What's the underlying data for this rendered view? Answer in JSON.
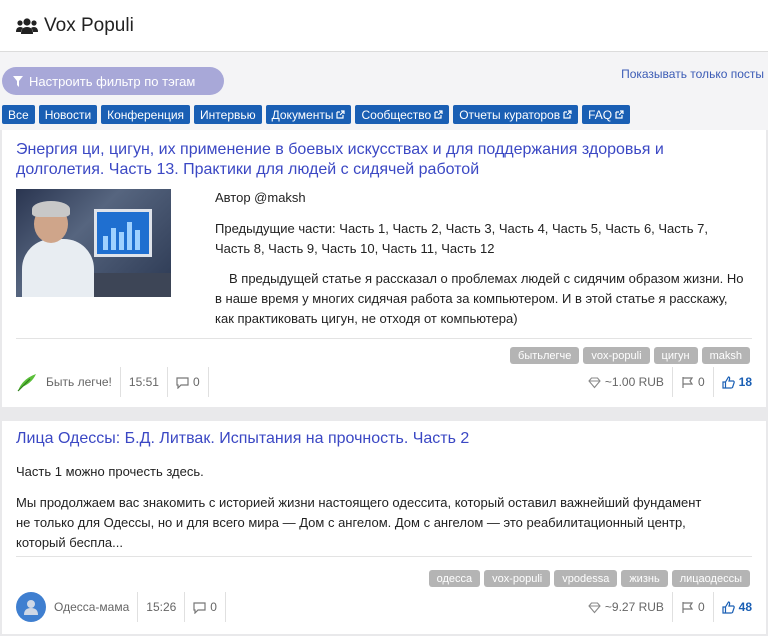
{
  "header": {
    "title": "Vox Populi"
  },
  "filter": {
    "button_label": "Настроить фильтр по тэгам",
    "posts_only": "Показывать только посты"
  },
  "tabs": [
    {
      "label": "Все",
      "external": false
    },
    {
      "label": "Новости",
      "external": false
    },
    {
      "label": "Конференция",
      "external": false
    },
    {
      "label": "Интервью",
      "external": false
    },
    {
      "label": "Документы",
      "external": true
    },
    {
      "label": "Сообщество",
      "external": true
    },
    {
      "label": "Отчеты кураторов",
      "external": true
    },
    {
      "label": "FAQ",
      "external": true
    }
  ],
  "posts": [
    {
      "title": "Энергия ци, цигун, их применение в боевых искусствах и для поддержания здоровья и долголетия. Часть 13. Практики для людей с сидячей работой",
      "author_line": "Автор @maksh",
      "previous": "Предыдущие части: Часть 1, Часть 2, Часть 3, Часть 4, Часть 5, Часть 6, Часть 7, Часть 8, Часть 9, Часть 10, Часть 11, Часть 12",
      "excerpt": "В предыдущей статье я рассказал о проблемах людей с сидячим образом жизни. Но в наше время у многих сидячая работа за компьютером. И в этой статье я расскажу, как практиковать цигун, не отходя от компьютера)",
      "tags": [
        "бытьлегче",
        "vox-populi",
        "цигун",
        "maksh"
      ],
      "community": "Быть легче!",
      "time": "15:51",
      "comments": "0",
      "payout": "~1.00 RUB",
      "flags": "0",
      "votes": "18"
    },
    {
      "title": "Лица Одессы: Б.Д. Литвак. Испытания на прочность. Часть 2",
      "line1": "Часть 1 можно прочесть здесь.",
      "excerpt": "Мы продолжаем вас знакомить с историей жизни настоящего одессита, который оставил важнейший фундамент не только для Одессы, но и для всего мира — Дом с ангелом. Дом с ангелом — это реабилитационный центр, который бесплa...",
      "tags": [
        "одесса",
        "vox-populi",
        "vpodessa",
        "жизнь",
        "лицаодессы"
      ],
      "community": "Одесса-мама",
      "time": "15:26",
      "comments": "0",
      "payout": "~9.27 RUB",
      "flags": "0",
      "votes": "48"
    }
  ]
}
